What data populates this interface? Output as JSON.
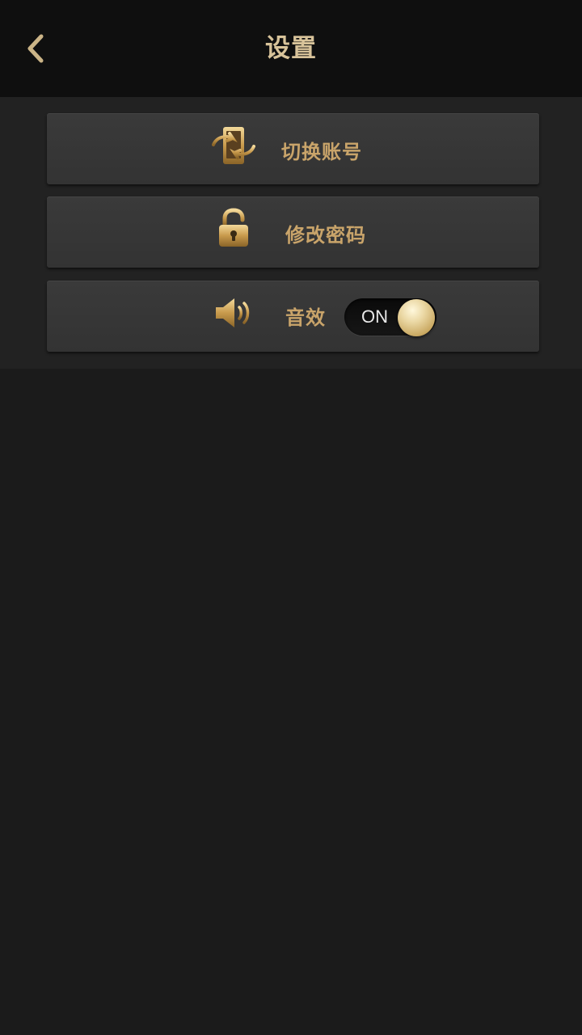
{
  "header": {
    "title": "设置",
    "back_icon": "chevron-left-icon"
  },
  "settings": {
    "items": [
      {
        "label": "切换账号",
        "icon": "switch-account-icon"
      },
      {
        "label": "修改密码",
        "icon": "unlocked-padlock-icon"
      },
      {
        "label": "音效",
        "icon": "speaker-icon"
      }
    ],
    "sound_toggle": {
      "state_text": "ON",
      "on": true
    }
  },
  "colors": {
    "accent_gold": "#c9a46a",
    "title_gold": "#d8c39a",
    "header_bg": "#0f0f0f",
    "page_bg": "#1b1b1b",
    "row_bg": "#363636"
  }
}
